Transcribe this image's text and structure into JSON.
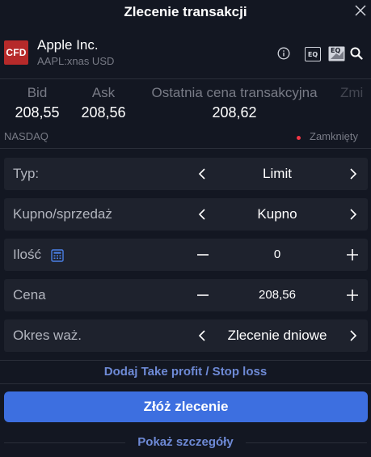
{
  "header": {
    "title": "Zlecenie transakcji"
  },
  "instrument": {
    "logo_text": "CFD",
    "name": "Apple Inc.",
    "symbol": "AAPL:xnas USD",
    "eq_label": "EQ",
    "eq2_label": "EQ"
  },
  "quotes": {
    "bid_label": "Bid",
    "bid_value": "208,55",
    "ask_label": "Ask",
    "ask_value": "208,56",
    "last_label": "Ostatnia cena transakcyjna",
    "last_value": "208,62",
    "change_label": "Zmi"
  },
  "market": {
    "exchange": "NASDAQ",
    "status": "Zamknięty",
    "status_color": "#f23645"
  },
  "form": {
    "type_label": "Typ:",
    "type_value": "Limit",
    "side_label": "Kupno/sprzedaż",
    "side_value": "Kupno",
    "qty_label": "Ilość",
    "qty_value": "0",
    "price_label": "Cena",
    "price_value": "208,56",
    "validity_label": "Okres waż.",
    "validity_value": "Zlecenie dniowe"
  },
  "actions": {
    "tp_sl_link": "Dodaj Take profit / Stop loss",
    "submit_label": "Złóż zlecenie",
    "details_link": "Pokaż szczegóły"
  },
  "colors": {
    "background": "#131722",
    "row_background": "#1e222d",
    "accent": "#3d6fe0",
    "link": "#6e8ad6",
    "logo": "#b62a2a"
  }
}
